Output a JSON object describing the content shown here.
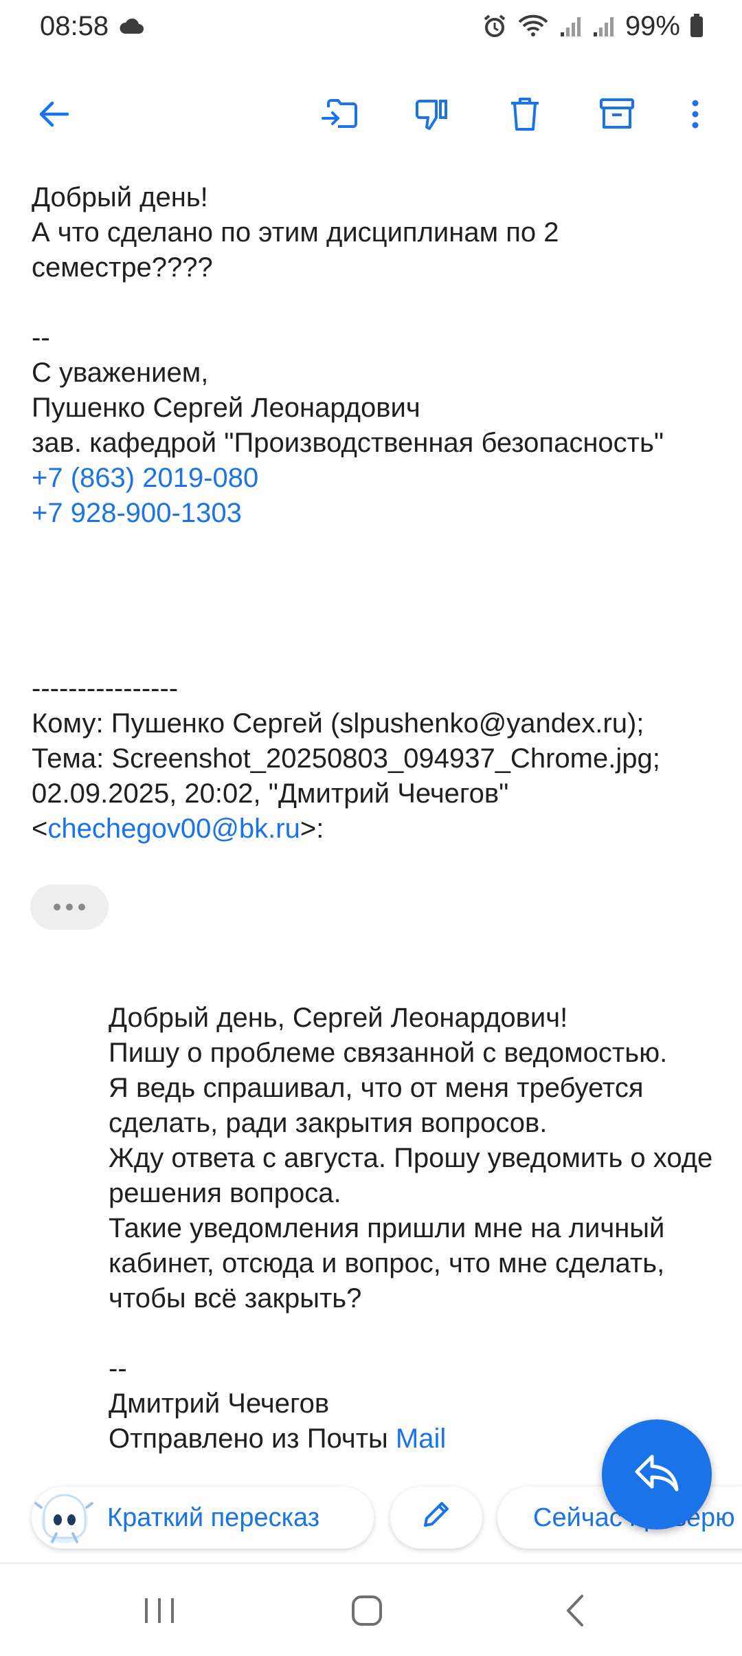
{
  "status_bar": {
    "time": "08:58",
    "battery": "99%",
    "icons": [
      "cloud-icon",
      "alarm-icon",
      "wifi-icon",
      "signal-icon",
      "signal-icon",
      "battery-icon"
    ]
  },
  "toolbar": {
    "icons": [
      "back-arrow-icon",
      "move-to-inbox-icon",
      "thumbs-down-icon",
      "delete-icon",
      "archive-icon",
      "more-vert-icon"
    ]
  },
  "message": {
    "greeting": "Добрый день!",
    "line2": "А что сделано по этим дисциплинам по 2 семестре????",
    "sig_sep": "--",
    "sig_regards": "С уважением,",
    "sig_name": "Пушенко Сергей Леонардович",
    "sig_title": "зав. кафедрой \"Производственная безопасность\"",
    "phone1": "+7 (863) 2019-080",
    "phone2": "+7 928-900-1303"
  },
  "header": {
    "sep": "----------------",
    "to": "Кому: Пушенко Сергей (slpushenko@yandex.ru);",
    "subject": "Тема: Screenshot_20250803_094937_Chrome.jpg;",
    "date_from": "02.09.2025, 20:02, \"Дмитрий Чечегов\"",
    "email_open": "<",
    "email": "chechegov00@bk.ru",
    "email_close": ">:"
  },
  "quoted": {
    "l1": "Добрый день, Сергей Леонардович!",
    "l2": "Пишу о проблеме связанной с ведомостью.",
    "l3": "Я ведь спрашивал, что от меня требуется сделать, ради закрытия вопросов.",
    "l4": "Жду ответа с августа. Прошу уведомить о ходе решения вопроса.",
    "l5": "Такие уведомления пришли мне на личный кабинет, отсюда и вопрос, что мне сделать, чтобы всё закрыть?",
    "sep": "--",
    "name": "Дмитрий Чечегов",
    "sent_prefix": "Отправлено из Почты ",
    "sent_link": "Mail"
  },
  "actions": {
    "summary_label": "Краткий пересказ",
    "now_label": "Сейчас проверю"
  },
  "colors": {
    "accent": "#1a73e8",
    "text": "#1f1f1f"
  }
}
